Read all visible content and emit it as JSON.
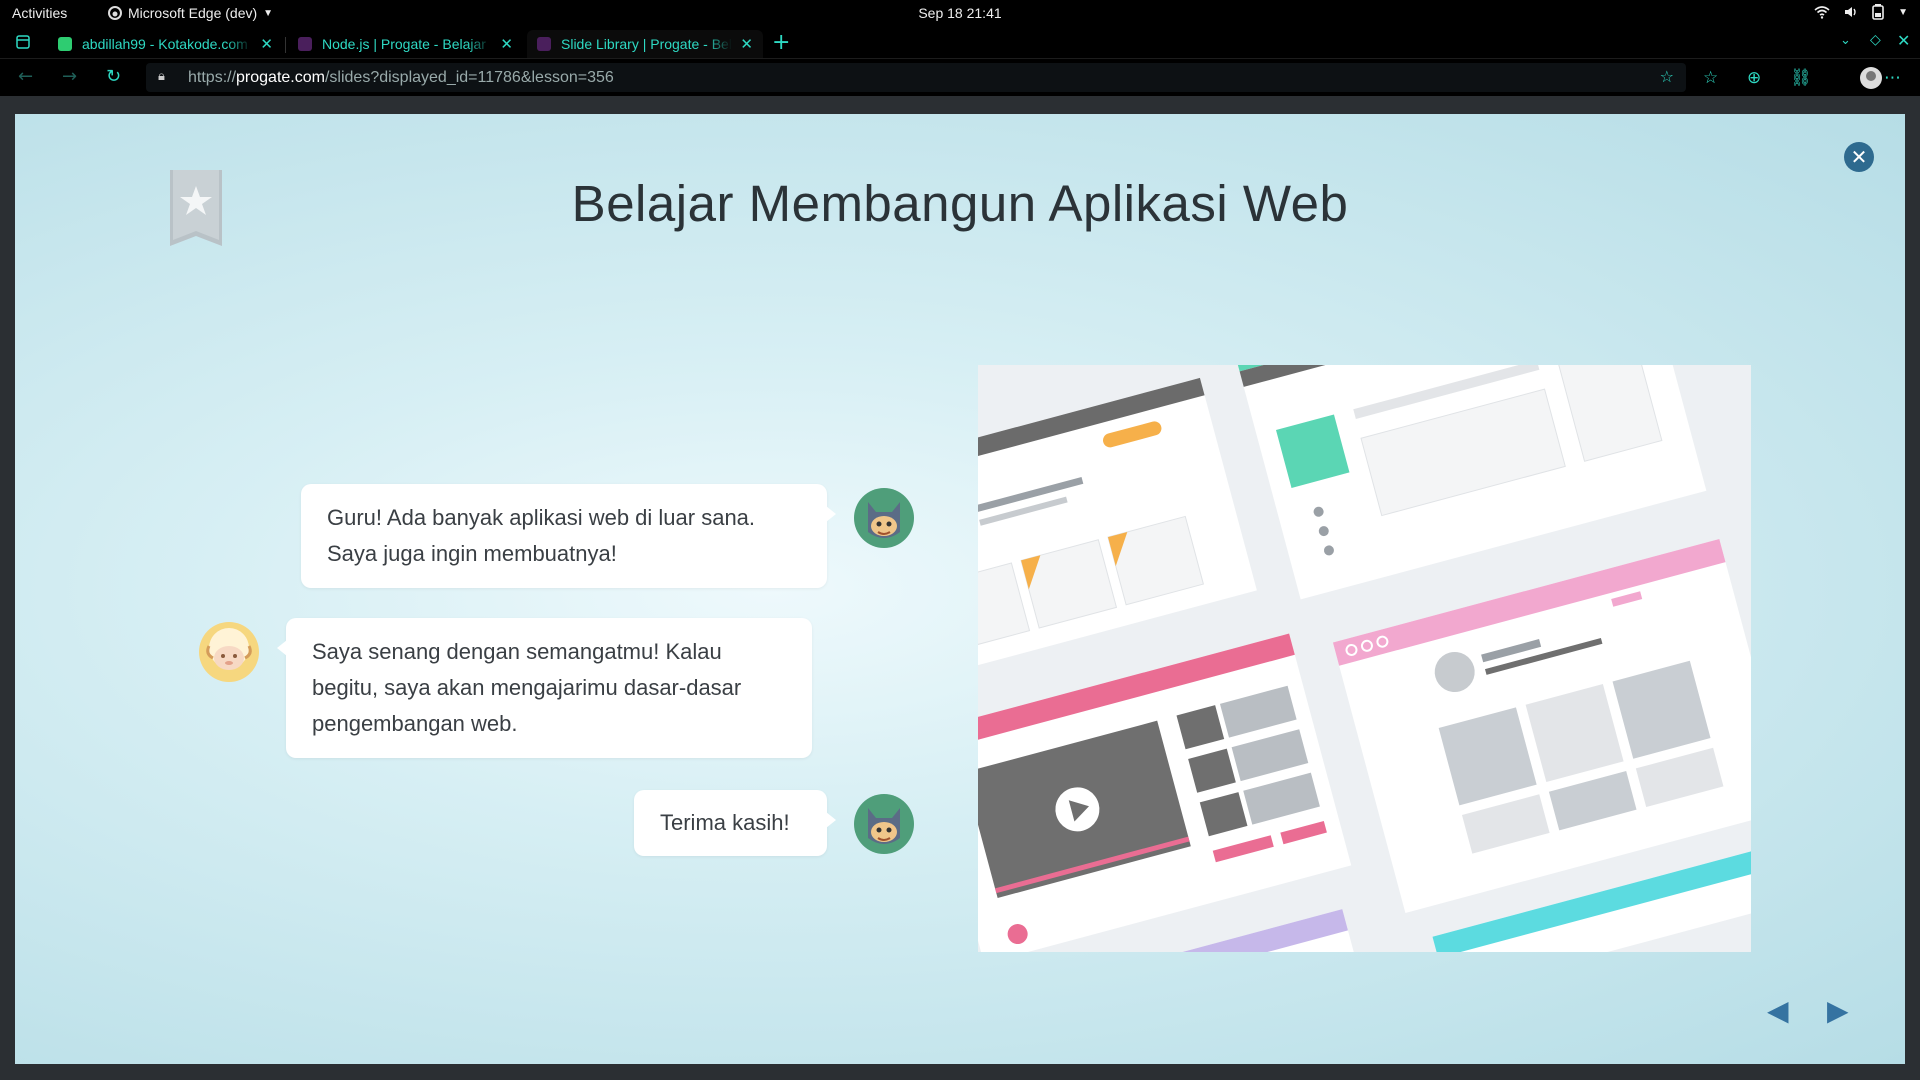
{
  "system": {
    "activities": "Activities",
    "app_name": "Microsoft Edge (dev)",
    "clock": "Sep 18  21:41"
  },
  "tabs": [
    {
      "title": "abdillah99 - Kotakode.com",
      "favicon_color": "#2ecc71"
    },
    {
      "title": "Node.js | Progate - Belajar",
      "favicon_color": "#4a1f5c"
    },
    {
      "title": "Slide Library | Progate - Belajar",
      "favicon_color": "#4a1f5c",
      "active": true
    }
  ],
  "address": {
    "url_prefix": "https://",
    "url_host": "progate.com",
    "url_path": "/slides?displayed_id=11786&lesson=356"
  },
  "slide": {
    "title": "Belajar Membangun Aplikasi Web",
    "dialog": [
      {
        "speaker": "student",
        "lines": [
          "Guru! Ada banyak aplikasi web di luar sana.",
          "Saya juga ingin membuatnya!"
        ]
      },
      {
        "speaker": "teacher",
        "lines": [
          "Saya senang dengan semangatmu! Kalau",
          "begitu, saya akan mengajarimu dasar-dasar",
          "pengembangan web."
        ]
      },
      {
        "speaker": "student",
        "lines": [
          "Terima kasih!"
        ]
      }
    ]
  },
  "colors": {
    "accent": "#2ed9c3",
    "close_button": "#2e6a8f",
    "nav_arrow": "#3573a1"
  }
}
